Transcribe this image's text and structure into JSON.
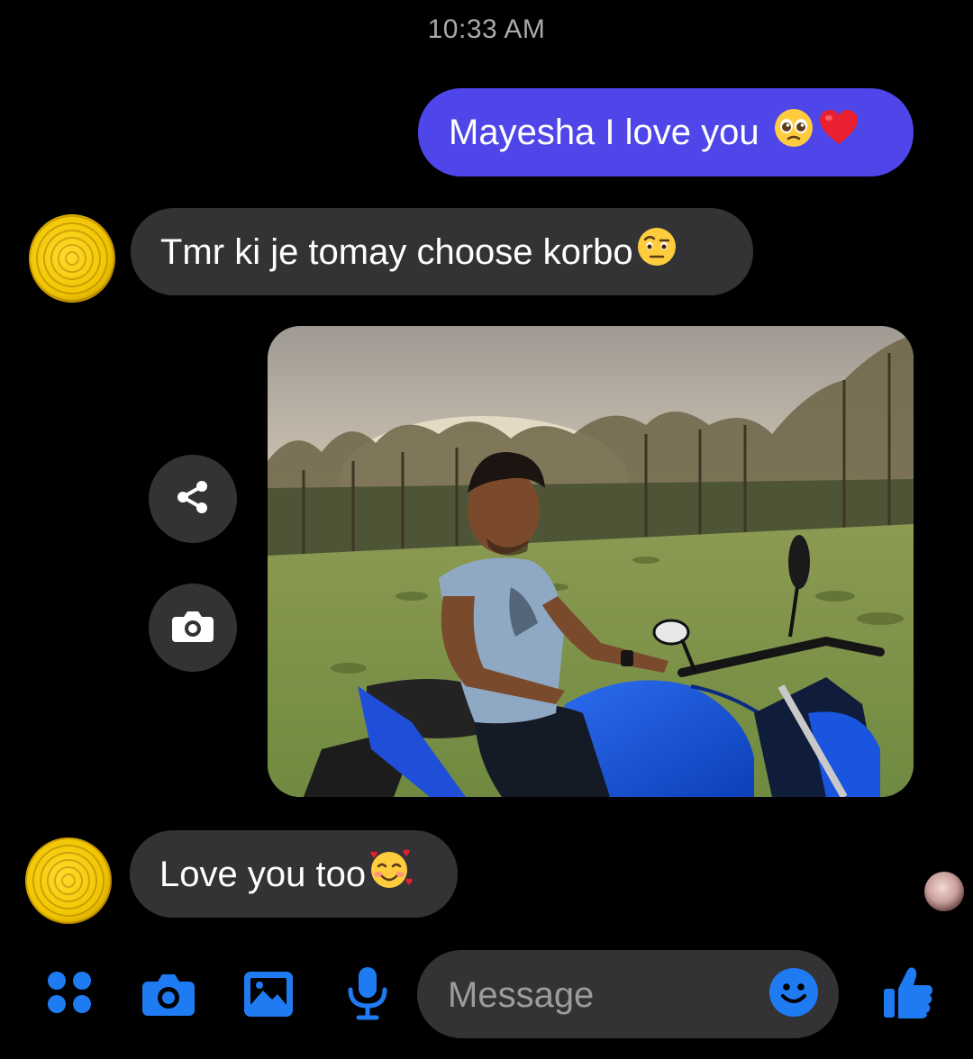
{
  "timestamp": "10:33 AM",
  "messages": [
    {
      "from": "me",
      "text": "Mayesha I love you",
      "emojis": [
        "pleading-face-emoji",
        "red-heart-emoji"
      ]
    },
    {
      "from": "them",
      "text": "Tmr ki je tomay choose korbo",
      "emojis": [
        "face-with-raised-eyebrow-emoji"
      ]
    },
    {
      "from": "them",
      "type": "photo"
    },
    {
      "from": "them",
      "text": "Love you too",
      "emojis": [
        "smiling-face-with-hearts-emoji"
      ]
    }
  ],
  "composer": {
    "placeholder": "Message"
  },
  "colors": {
    "sent_bubble": "#4e46e8",
    "received_bubble": "#333335",
    "accent": "#1f7bf2"
  },
  "icons": [
    "share-icon",
    "camera-icon",
    "apps-icon",
    "gallery-icon",
    "microphone-icon",
    "emoji-icon",
    "thumbs-up-icon"
  ]
}
